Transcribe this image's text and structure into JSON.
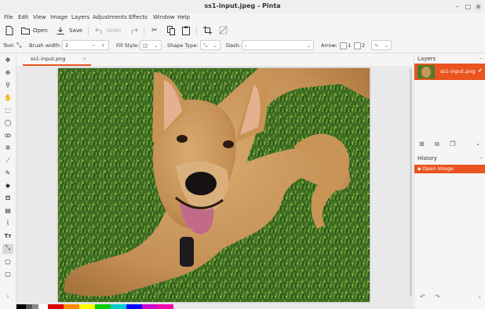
{
  "window": {
    "title": "ss1-input.jpeg - Pinta"
  },
  "menu": [
    "File",
    "Edit",
    "View",
    "Image",
    "Layers",
    "Adjustments",
    "Effects",
    "Window",
    "Help"
  ],
  "toolbar": {
    "open_label": "Open",
    "save_label": "Save",
    "undo_label": "Undo",
    "redo_label": "Redo"
  },
  "options": {
    "tool_label": "Tool:",
    "brush_width_label": "Brush width:",
    "brush_width_value": "2",
    "fill_style_label": "Fill Style:",
    "shape_type_label": "Shape Type:",
    "dash_label": "Dash:",
    "dash_value": "-",
    "arrow_label": "Arrow:",
    "arrow_1": "1",
    "arrow_2": "2"
  },
  "tabs": [
    {
      "label": "ss1-input.png"
    }
  ],
  "layers_panel": {
    "title": "Layers",
    "items": [
      {
        "label": "ss1-input.png",
        "visible": true
      }
    ]
  },
  "history_panel": {
    "title": "History",
    "items": [
      {
        "label": "Open Image"
      }
    ]
  },
  "colors": {
    "accent": "#e95420"
  }
}
